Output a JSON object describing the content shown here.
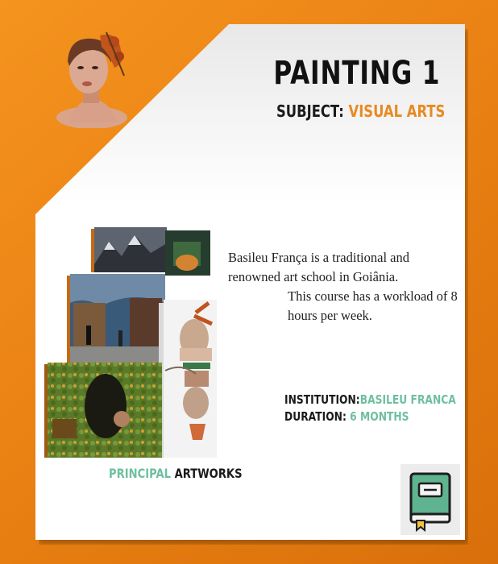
{
  "header": {
    "title": "PAINTING 1",
    "subject_label": "SUBJECT:",
    "subject_value": "VISUAL ARTS"
  },
  "description": {
    "line1": "Basileu França is a traditional and renowned art school in Goiânia.",
    "line2": "This course has a workload of 8 hours per week."
  },
  "details": {
    "institution_label": "INSTITUTION:",
    "institution_value": "BASILEU FRANCA",
    "duration_label": "DURATION:",
    "duration_value": "6 MONTHS"
  },
  "caption": {
    "highlight": "PRINCIPAL",
    "rest": "ARTWORKS"
  },
  "colors": {
    "background": "#f08a1c",
    "accent_orange": "#e88a22",
    "accent_green": "#6fbf9f",
    "book": "#5fb38f"
  },
  "icons": {
    "book": "book-icon"
  }
}
